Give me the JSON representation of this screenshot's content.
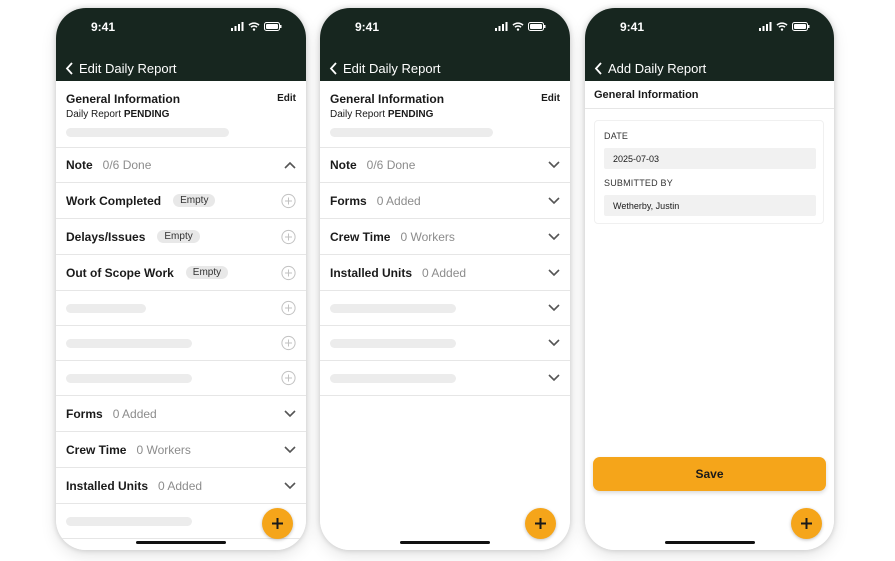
{
  "status_time": "9:41",
  "screen1": {
    "title": "Edit Daily Report",
    "general": {
      "heading": "General Information",
      "edit_label": "Edit",
      "report_label": "Daily Report",
      "status": "PENDING"
    },
    "rows": [
      {
        "label": "Note",
        "count": "0/6 Done"
      },
      {
        "label": "Work Completed",
        "badge": "Empty"
      },
      {
        "label": "Delays/Issues",
        "badge": "Empty"
      },
      {
        "label": "Out of Scope Work",
        "badge": "Empty"
      },
      {
        "label": "Forms",
        "count": "0 Added"
      },
      {
        "label": "Crew Time",
        "count": "0 Workers"
      },
      {
        "label": "Installed Units",
        "count": "0 Added"
      }
    ]
  },
  "screen2": {
    "title": "Edit Daily Report",
    "general": {
      "heading": "General Information",
      "edit_label": "Edit",
      "report_label": "Daily Report",
      "status": "PENDING"
    },
    "rows": [
      {
        "label": "Note",
        "count": "0/6 Done"
      },
      {
        "label": "Forms",
        "count": "0 Added"
      },
      {
        "label": "Crew Time",
        "count": "0 Workers"
      },
      {
        "label": "Installed Units",
        "count": "0 Added"
      }
    ]
  },
  "screen3": {
    "title": "Add Daily Report",
    "section": "General Information",
    "date_label": "DATE",
    "date_value": "2025-07-03",
    "submitted_label": "SUBMITTED BY",
    "submitted_value": "Wetherby, Justin",
    "save_label": "Save"
  },
  "icons": {
    "back": "chevron-left-icon",
    "expand": "chevron-down-icon",
    "collapse": "chevron-up-icon",
    "add_item": "plus-circle-icon",
    "fab": "plus-icon",
    "signal": "signal-icon",
    "wifi": "wifi-icon",
    "battery": "battery-icon"
  },
  "colors": {
    "header_bg": "#17261f",
    "accent": "#f5a51a",
    "skeleton": "#ececec",
    "divider": "#e6e6e6"
  }
}
